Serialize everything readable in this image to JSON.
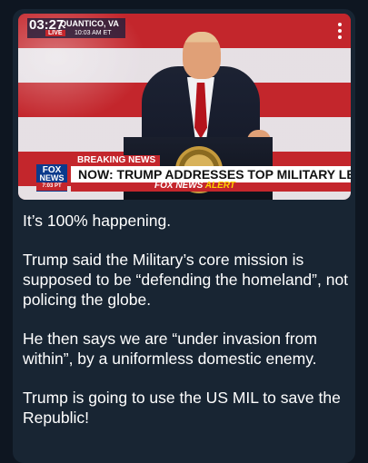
{
  "message": {
    "video": {
      "live_time": "03:27",
      "location": "QUANTICO, VA",
      "live_label": "LIVE",
      "live_time_small": "10:03 AM ET",
      "breaking_label": "BREAKING NEWS",
      "headline": "NOW: TRUMP ADDRESSES TOP MILITARY LEADERS",
      "network_logo_line1": "FOX",
      "network_logo_line2": "NEWS",
      "network_time": "7:03 PT",
      "alert_brand": "FOX NEWS",
      "alert_word": "ALERT"
    },
    "paragraphs": [
      "It’s 100% happening.",
      "Trump said the Military’s core mission is supposed to be “defending the homeland”, not policing the globe.",
      "He then says we are “under invasion from within”, by a uniformless domestic enemy.",
      "Trump is going to use the US MIL to save the Republic!"
    ]
  },
  "colors": {
    "background": "#0e1621",
    "bubble": "#182533",
    "fox_red": "#c4262c",
    "fox_blue": "#0b3a8c"
  }
}
